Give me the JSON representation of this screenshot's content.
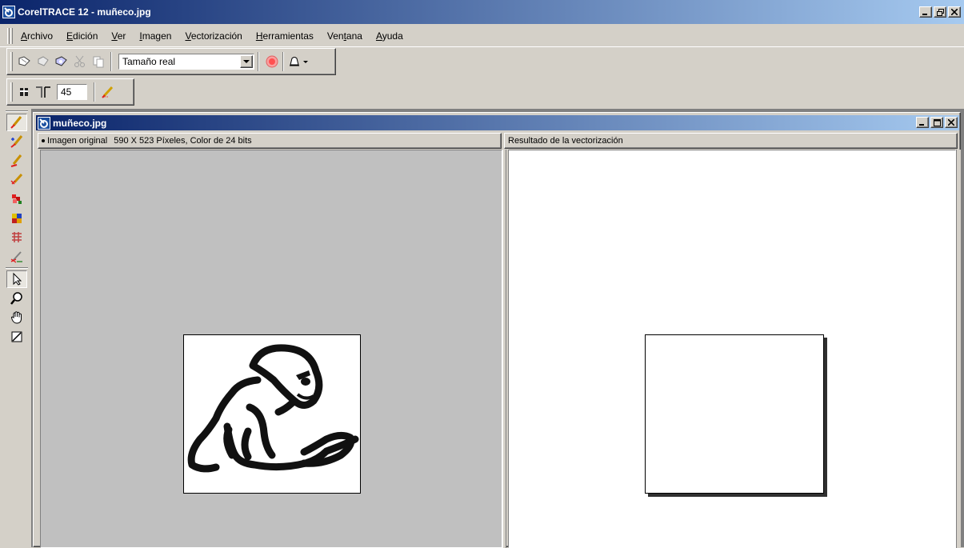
{
  "app": {
    "title": "CorelTRACE 12 - muñeco.jpg",
    "window_buttons": {
      "minimize": "_",
      "maximize": "▫",
      "close": "✕"
    }
  },
  "menu": [
    {
      "label": "Archivo"
    },
    {
      "label": "Edición"
    },
    {
      "label": "Ver"
    },
    {
      "label": "Imagen"
    },
    {
      "label": "Vectorización"
    },
    {
      "label": "Herramientas"
    },
    {
      "label": "Ventana"
    },
    {
      "label": "Ayuda"
    }
  ],
  "toolbar": {
    "zoom_combo": {
      "value": "Tamaño real"
    },
    "icons": [
      "open-icon",
      "save-icon",
      "import-icon",
      "cut-icon",
      "copy-icon",
      "record-icon",
      "bell-icon"
    ],
    "settings_value": "45"
  },
  "tools": [
    "trace-outline-icon",
    "trace-centerline-icon",
    "trace-woodcut-icon",
    "trace-sketch-icon",
    "trace-mosaic-icon",
    "trace-3d-mosaic-icon",
    "trace-form-icon",
    "trace-ocr-icon",
    "pointer-icon",
    "zoom-icon",
    "hand-icon",
    "eraser-icon"
  ],
  "document": {
    "title": "muñeco.jpg",
    "left_pane": {
      "label": "Imagen original",
      "info": "590 X 523 Píxeles, Color de 24 bits"
    },
    "right_pane": {
      "label": "Resultado de la vectorización"
    }
  },
  "colors": {
    "titlebar_start": "#0a246a",
    "titlebar_end": "#a6caf0",
    "face": "#d4d0c8",
    "workspace": "#c0c0c0"
  }
}
